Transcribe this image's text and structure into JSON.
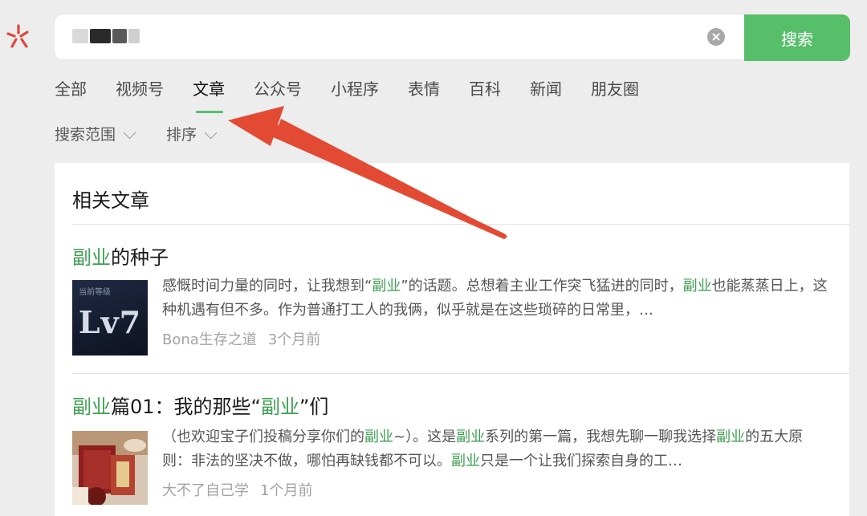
{
  "colors": {
    "accent": "#57be6a",
    "highlight": "#3f9f52",
    "logo": "#e0473b",
    "annotation_arrow": "#e34a34"
  },
  "search": {
    "button_label": "搜索",
    "clear_icon": "clear-circle-icon"
  },
  "tabs": [
    {
      "label": "全部"
    },
    {
      "label": "视频号"
    },
    {
      "label": "文章",
      "active": true
    },
    {
      "label": "公众号"
    },
    {
      "label": "小程序"
    },
    {
      "label": "表情"
    },
    {
      "label": "百科"
    },
    {
      "label": "新闻"
    },
    {
      "label": "朋友圈"
    }
  ],
  "filters": [
    {
      "label": "搜索范围"
    },
    {
      "label": "排序"
    }
  ],
  "results": {
    "section_title": "相关文章",
    "articles": [
      {
        "title_hl": "副业",
        "title_rest": "的种子",
        "snippet": [
          {
            "t": "感慨时间力量的同时，让我想到“"
          },
          {
            "t": "副业",
            "hl": true
          },
          {
            "t": "”的话题。总想着主业工作突飞猛进的同时，"
          },
          {
            "t": "副业",
            "hl": true
          },
          {
            "t": "也能蒸蒸日上，这种机遇有但不多。作为普通打工人的我俩，似乎就是在这些琐碎的日常里，…"
          }
        ],
        "author": "Bona生存之道",
        "time": "3个月前",
        "thumb_caption": "当前等级",
        "thumb_text": "Lv7"
      },
      {
        "title_parts": [
          {
            "t": "副业",
            "hl": true
          },
          {
            "t": "篇01：我的那些“"
          },
          {
            "t": "副业",
            "hl": true
          },
          {
            "t": "”们"
          }
        ],
        "snippet": [
          {
            "t": "（也欢迎宝子们投稿分享你们的"
          },
          {
            "t": "副业",
            "hl": true
          },
          {
            "t": "~）。这是"
          },
          {
            "t": "副业",
            "hl": true
          },
          {
            "t": "系列的第一篇，我想先聊一聊我选择"
          },
          {
            "t": "副业",
            "hl": true
          },
          {
            "t": "的五大原则：非法的坚决不做，哪怕再缺钱都不可以。"
          },
          {
            "t": "副业",
            "hl": true
          },
          {
            "t": "只是一个让我们探索自身的工…"
          }
        ],
        "author": "大不了自己学",
        "time": "1个月前"
      }
    ]
  }
}
